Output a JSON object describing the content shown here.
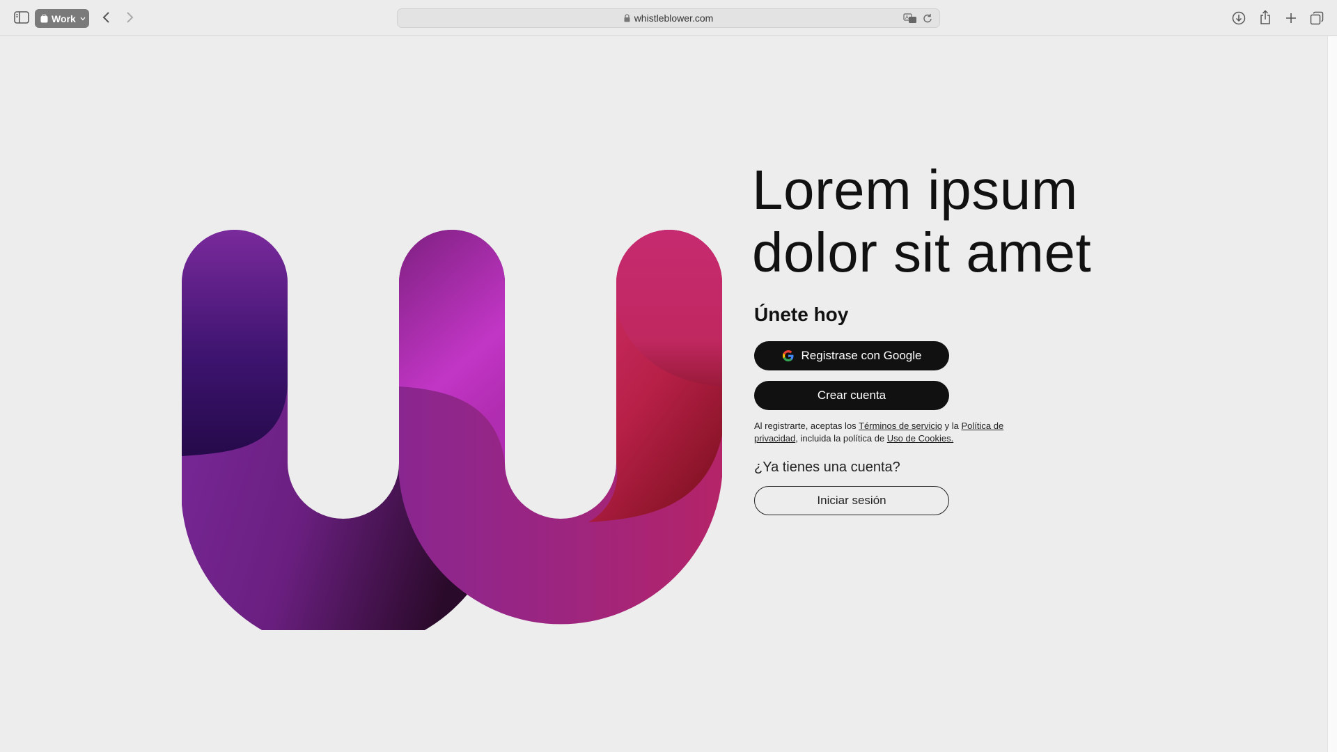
{
  "browser": {
    "tab_group_label": "Work",
    "url": "whistleblower.com"
  },
  "hero": {
    "title_line1": "Lorem ipsum",
    "title_line2": "dolor sit amet"
  },
  "signup": {
    "heading": "Únete hoy",
    "google_button": "Registrase con Google",
    "create_button": "Crear cuenta",
    "legal": {
      "prefix": "Al registrarte, aceptas los ",
      "terms_link": "Términos de servicio",
      "middle": " y la ",
      "privacy_link": "Política de privacidad",
      "after_privacy": ", incluida la política de ",
      "cookies_link": "Uso de Cookies."
    }
  },
  "login": {
    "question": "¿Ya tienes una cuenta?",
    "button": "Iniciar sesión"
  },
  "colors": {
    "background": "#ededed",
    "button_dark": "#111111",
    "logo_purple": "#7a2aa0",
    "logo_magenta": "#c42a7a"
  },
  "icons": [
    "sidebar-icon",
    "tab-group-icon",
    "chevron-left-icon",
    "chevron-right-icon",
    "lock-icon",
    "translate-icon",
    "reload-icon",
    "download-icon",
    "share-icon",
    "plus-icon",
    "tabs-overview-icon",
    "google-icon"
  ]
}
